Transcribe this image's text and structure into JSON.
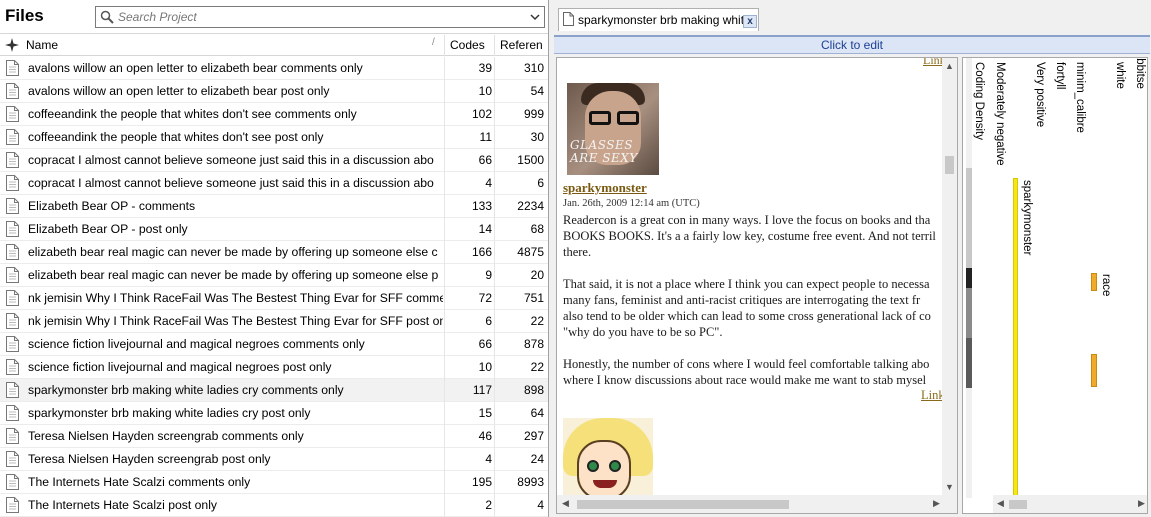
{
  "files": {
    "title": "Files",
    "search_placeholder": "Search Project",
    "columns": {
      "name": "Name",
      "codes": "Codes",
      "references": "Referen"
    },
    "rows": [
      {
        "name": "avalons willow an open letter to elizabeth bear comments only",
        "codes": "39",
        "refs": "310"
      },
      {
        "name": "avalons willow an open letter to elizabeth bear post only",
        "codes": "10",
        "refs": "54"
      },
      {
        "name": "coffeeandink the people that whites don't see comments only",
        "codes": "102",
        "refs": "999"
      },
      {
        "name": "coffeeandink the people that whites don't see post only",
        "codes": "11",
        "refs": "30"
      },
      {
        "name": "copracat I almost cannot believe someone just said this in a discussion abo",
        "codes": "66",
        "refs": "1500"
      },
      {
        "name": "copracat I almost cannot believe someone just said this in a discussion abo",
        "codes": "4",
        "refs": "6"
      },
      {
        "name": "Elizabeth Bear OP - comments",
        "codes": "133",
        "refs": "2234"
      },
      {
        "name": "Elizabeth Bear OP - post only",
        "codes": "14",
        "refs": "68"
      },
      {
        "name": "elizabeth bear real magic can never be made by offering up someone else c",
        "codes": "166",
        "refs": "4875"
      },
      {
        "name": "elizabeth bear real magic can never be made by offering up someone else p",
        "codes": "9",
        "refs": "20"
      },
      {
        "name": "nk jemisin Why I Think RaceFail Was The Bestest Thing Evar for SFF commen",
        "codes": "72",
        "refs": "751"
      },
      {
        "name": "nk jemisin Why I Think RaceFail Was The Bestest Thing Evar for SFF post onl",
        "codes": "6",
        "refs": "22"
      },
      {
        "name": "science fiction livejournal and magical negroes comments only",
        "codes": "66",
        "refs": "878"
      },
      {
        "name": "science fiction livejournal and magical negroes post only",
        "codes": "10",
        "refs": "22"
      },
      {
        "name": "sparkymonster brb making white ladies cry comments only",
        "codes": "117",
        "refs": "898"
      },
      {
        "name": "sparkymonster brb making white ladies cry post only",
        "codes": "15",
        "refs": "64"
      },
      {
        "name": "Teresa Nielsen Hayden screengrab comments only",
        "codes": "46",
        "refs": "297"
      },
      {
        "name": "Teresa Nielsen Hayden screengrab post only",
        "codes": "4",
        "refs": "24"
      },
      {
        "name": "The Internets Hate Scalzi comments only",
        "codes": "195",
        "refs": "8993"
      },
      {
        "name": "The Internets Hate Scalzi post only",
        "codes": "2",
        "refs": "4"
      }
    ]
  },
  "tab": {
    "label": "sparkymonster brb making white",
    "close": "x"
  },
  "click_to_edit": "Click to edit",
  "document": {
    "top_link": "Link",
    "avatar_text_line1": "GLASSES",
    "avatar_text_line2": "ARE SEXY",
    "author": "sparkymonster",
    "date": "Jan. 26th, 2009 12:14 am (UTC)",
    "paragraph1": [
      "Readercon is a great con in many ways. I love the focus on books and tha",
      "BOOKS BOOKS. It's a a fairly low key, costume free event. And not terril",
      "there."
    ],
    "paragraph2": [
      "That said, it is not a place where I think you can expect people to necessa",
      "many fans, feminist and anti-racist critiques are interrogating the text fr",
      "also tend to be older which can lead to some cross generational lack of co",
      "\"why do you have to be so PC\"."
    ],
    "paragraph3": [
      "Honestly, the number of cons where I would feel comfortable talking abo",
      "where I know discussions about race would make me want to stab mysel"
    ],
    "bottom_link": "Link"
  },
  "stripes": {
    "labels": [
      "Coding Density",
      "Moderately negative",
      "Very positive",
      "fortyll",
      "minim_calibre",
      "white",
      "rabbitse"
    ],
    "bar_labels": {
      "sparky": "sparkymonster",
      "race": "race"
    }
  }
}
